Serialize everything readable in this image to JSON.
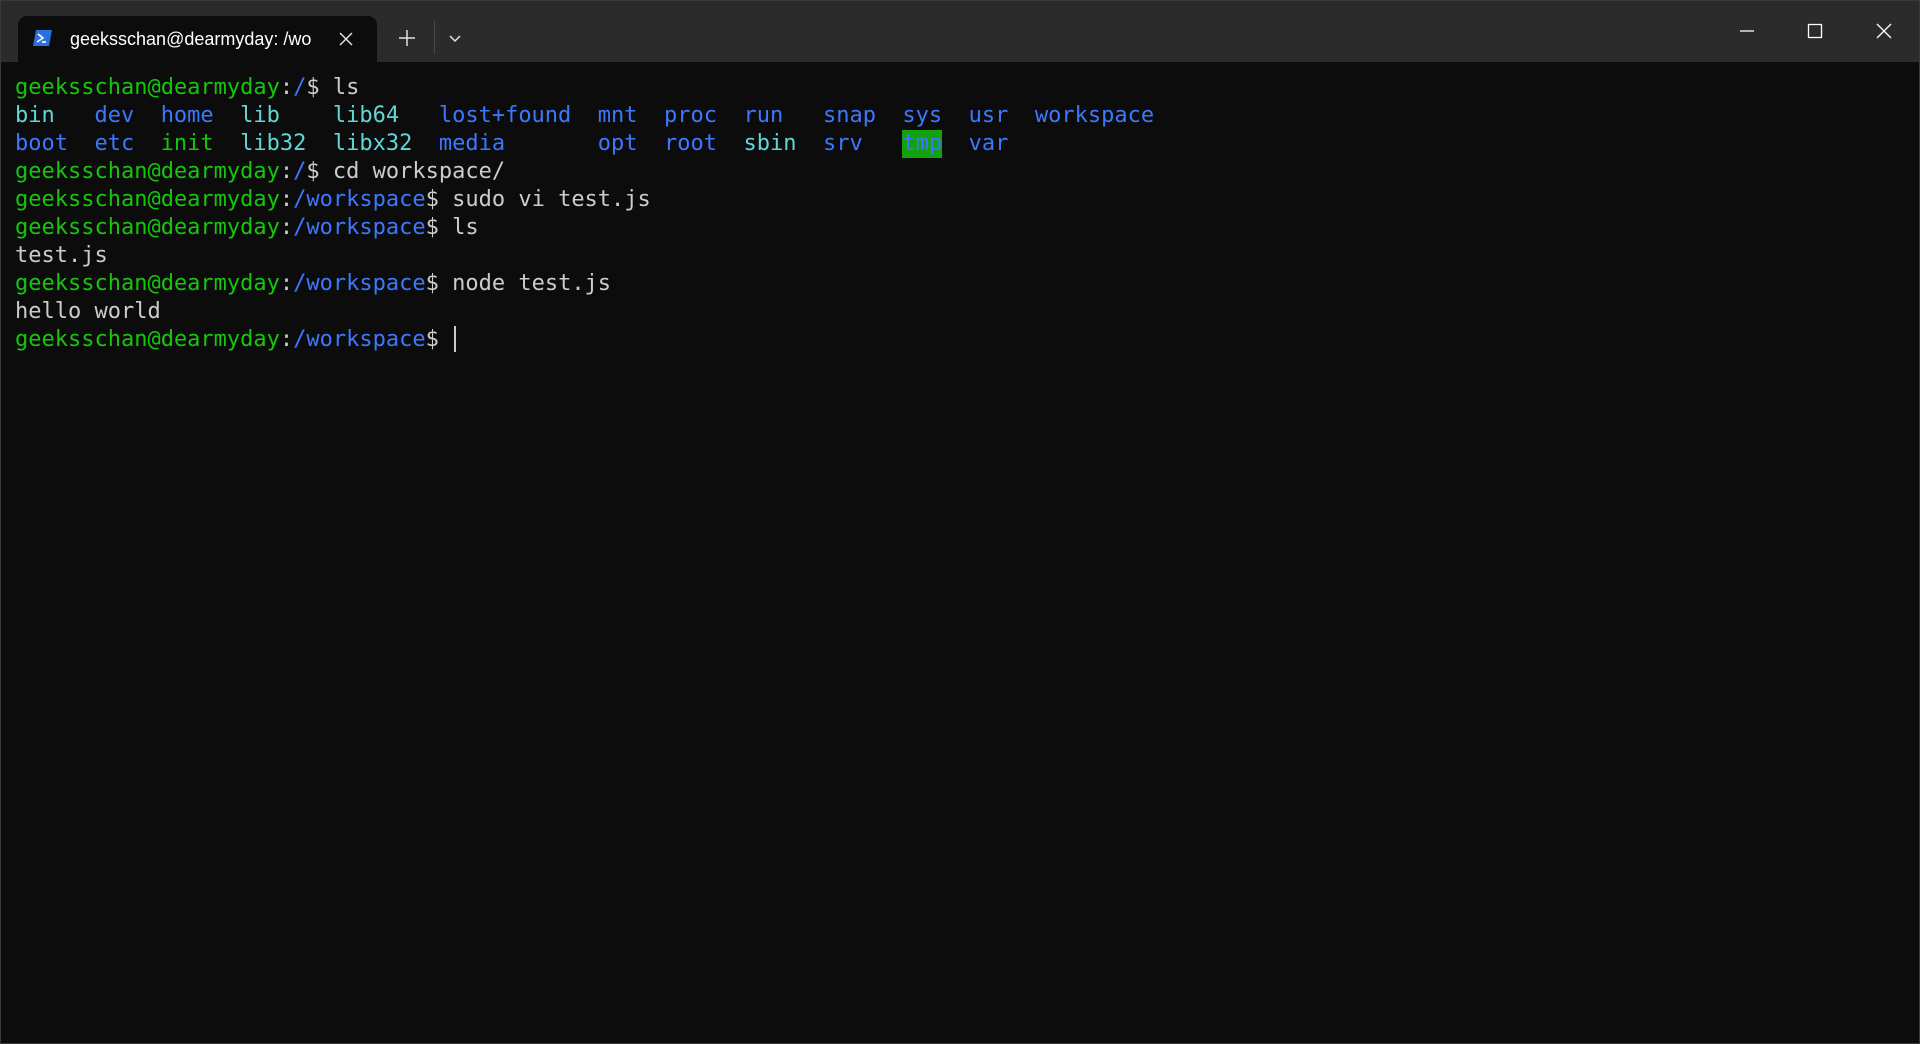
{
  "window": {
    "tab_title": "geeksschan@dearmyday: /wo",
    "controls": {
      "new_tab": "+",
      "minimize": "minimize",
      "maximize": "maximize",
      "close": "close"
    },
    "icons": {
      "tab": "powershell-icon",
      "tab_close": "close-icon",
      "new_tab": "plus-icon",
      "dropdown": "chevron-down-icon"
    }
  },
  "terminal": {
    "colors": {
      "background": "#0c0c0c",
      "foreground": "#cccccc",
      "prompt_user": "#16c60c",
      "prompt_path": "#3b78ff",
      "dir_cyan": "#61d6d6",
      "tmp_highlight": "#13a10e"
    },
    "prompt_user": "geeksschan@dearmyday",
    "lines": [
      {
        "type": "prompt",
        "path": "/",
        "command": "ls"
      },
      {
        "type": "ls",
        "items": [
          {
            "name": "bin",
            "style": "dircyan",
            "col": 0
          },
          {
            "name": "dev",
            "style": "dirblue",
            "col": 6
          },
          {
            "name": "home",
            "style": "dirblue",
            "col": 11
          },
          {
            "name": "lib",
            "style": "dircyan",
            "col": 17
          },
          {
            "name": "lib64",
            "style": "dircyan",
            "col": 24
          },
          {
            "name": "lost+found",
            "style": "dirblue",
            "col": 32
          },
          {
            "name": "mnt",
            "style": "dirblue",
            "col": 44
          },
          {
            "name": "proc",
            "style": "dirblue",
            "col": 49
          },
          {
            "name": "run",
            "style": "dirblue",
            "col": 55
          },
          {
            "name": "snap",
            "style": "dirblue",
            "col": 61
          },
          {
            "name": "sys",
            "style": "dirblue",
            "col": 67
          },
          {
            "name": "usr",
            "style": "dirblue",
            "col": 72
          },
          {
            "name": "workspace",
            "style": "dirblue",
            "col": 77
          }
        ]
      },
      {
        "type": "ls",
        "items": [
          {
            "name": "boot",
            "style": "dirblue",
            "col": 0
          },
          {
            "name": "etc",
            "style": "dirblue",
            "col": 6
          },
          {
            "name": "init",
            "style": "dirgreen",
            "col": 11
          },
          {
            "name": "lib32",
            "style": "dircyan",
            "col": 17
          },
          {
            "name": "libx32",
            "style": "dircyan",
            "col": 24
          },
          {
            "name": "media",
            "style": "dirblue",
            "col": 32
          },
          {
            "name": "opt",
            "style": "dirblue",
            "col": 44
          },
          {
            "name": "root",
            "style": "dirblue",
            "col": 49
          },
          {
            "name": "sbin",
            "style": "dircyan",
            "col": 55
          },
          {
            "name": "srv",
            "style": "dirblue",
            "col": 61
          },
          {
            "name": "tmp",
            "style": "hl-green",
            "col": 67
          },
          {
            "name": "var",
            "style": "dirblue",
            "col": 72
          }
        ]
      },
      {
        "type": "prompt",
        "path": "/",
        "command": "cd workspace/"
      },
      {
        "type": "prompt",
        "path": "/workspace",
        "command": "sudo vi test.js"
      },
      {
        "type": "prompt",
        "path": "/workspace",
        "command": "ls"
      },
      {
        "type": "output",
        "text": "test.js"
      },
      {
        "type": "prompt",
        "path": "/workspace",
        "command": "node test.js"
      },
      {
        "type": "output",
        "text": "hello world"
      },
      {
        "type": "prompt",
        "path": "/workspace",
        "command": "",
        "cursor": true
      }
    ]
  }
}
